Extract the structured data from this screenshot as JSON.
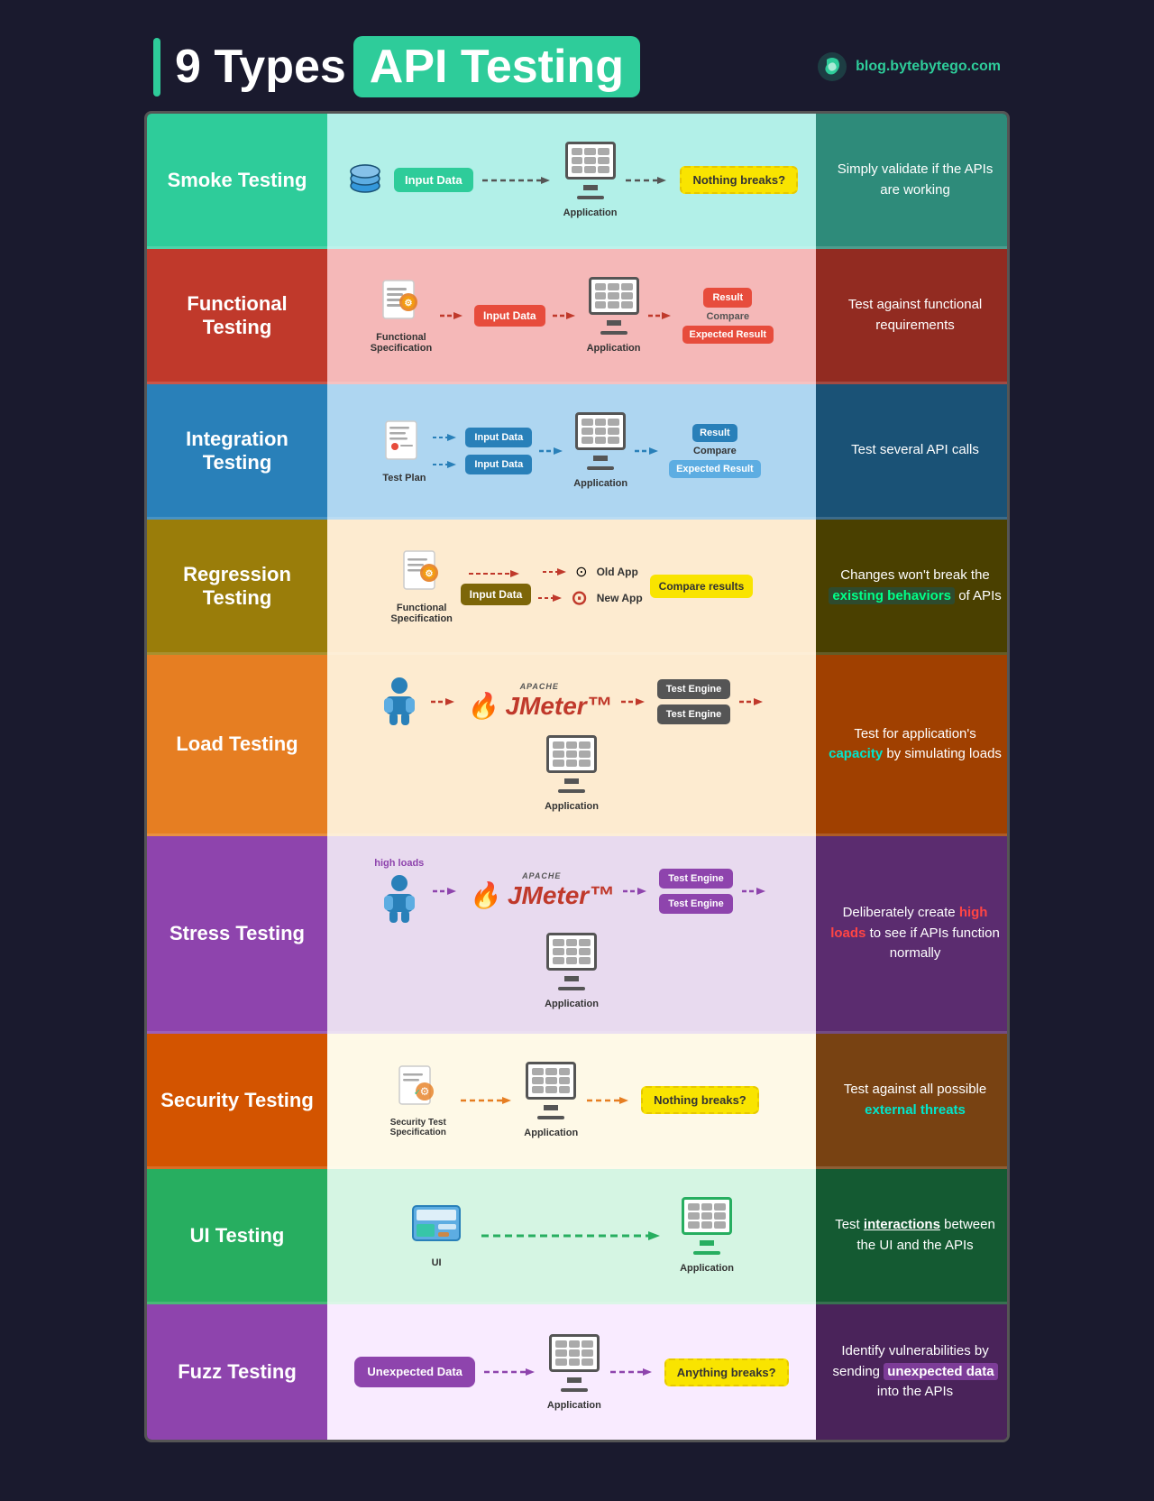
{
  "header": {
    "title_prefix": "9 Types ",
    "title_api": "API Testing",
    "brand": "blog.bytebytego.com"
  },
  "rows": [
    {
      "id": "smoke",
      "left_label": "Smoke Testing",
      "right_text": "Simply validate if the APIs are working"
    },
    {
      "id": "functional",
      "left_label": "Functional Testing",
      "right_text": "Test against functional requirements"
    },
    {
      "id": "integration",
      "left_label": "Integration Testing",
      "right_text": "Test several API calls"
    },
    {
      "id": "regression",
      "left_label": "Regression Testing",
      "right_text": "Changes won't break the existing behaviors of APIs"
    },
    {
      "id": "load",
      "left_label": "Load Testing",
      "right_text": "Test for application's capacity by simulating loads"
    },
    {
      "id": "stress",
      "left_label": "Stress Testing",
      "right_text": "Deliberately create high loads to see if APIs function normally"
    },
    {
      "id": "security",
      "left_label": "Security Testing",
      "right_text": "Test against all possible external threats"
    },
    {
      "id": "ui",
      "left_label": "UI Testing",
      "right_text": "Test interactions between the UI and the APIs"
    },
    {
      "id": "fuzz",
      "left_label": "Fuzz Testing",
      "right_text": "Identify vulnerabilities by sending unexpected data into the APIs"
    }
  ],
  "labels": {
    "input_data": "Input Data",
    "application": "Application",
    "nothing_breaks": "Nothing breaks?",
    "anything_breaks": "Anything breaks?",
    "result": "Result",
    "expected_result": "Expected Result",
    "compare": "Compare",
    "test_plan": "Test Plan",
    "functional_spec": "Functional Specification",
    "old_app": "Old App",
    "new_app": "New App",
    "compare_results": "Compare results",
    "test_engine": "Test Engine",
    "high_loads": "high loads",
    "security_spec": "Security Test Specification",
    "ui_label": "UI",
    "unexpected_data": "Unexpected Data",
    "jmeter": "JMeter",
    "apache": "APACHE"
  }
}
